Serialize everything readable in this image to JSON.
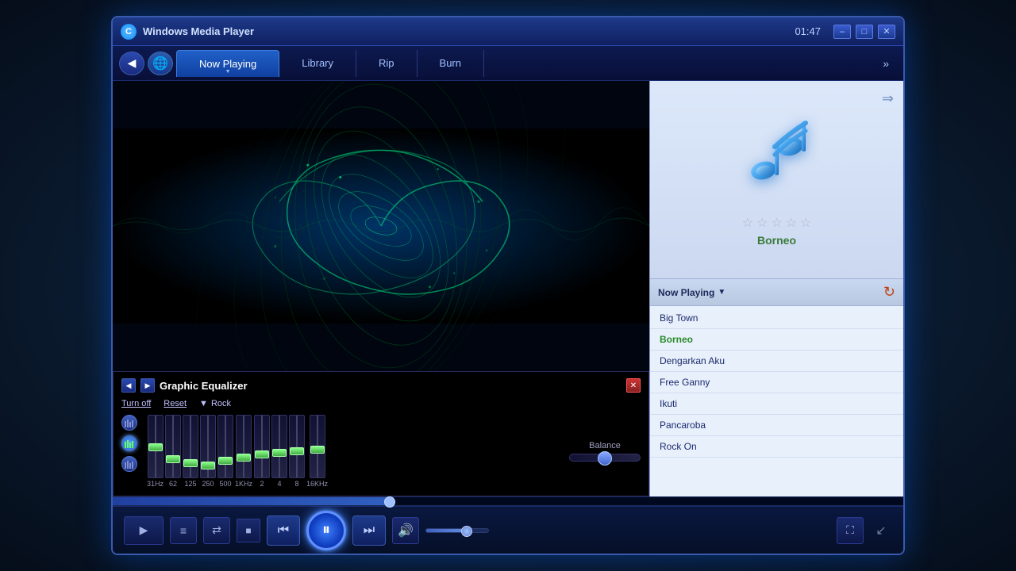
{
  "window": {
    "title": "Windows Media Player",
    "time": "01:47",
    "icon": "C"
  },
  "titlebar": {
    "minimize_label": "–",
    "restore_label": "□",
    "close_label": "✕"
  },
  "navbar": {
    "tabs": [
      {
        "id": "now-playing",
        "label": "Now Playing",
        "active": true
      },
      {
        "id": "library",
        "label": "Library",
        "active": false
      },
      {
        "id": "rip",
        "label": "Rip",
        "active": false
      },
      {
        "id": "burn",
        "label": "Burn",
        "active": false
      }
    ],
    "more_label": "»"
  },
  "equalizer": {
    "title": "Graphic Equalizer",
    "turn_off_label": "Turn off",
    "reset_label": "Reset",
    "preset_label": "Rock",
    "close_label": "✕",
    "frequencies": [
      "31Hz",
      "62",
      "125",
      "250",
      "500",
      "1KHz",
      "2",
      "4",
      "8",
      "16KHz"
    ],
    "slider_positions": [
      50,
      35,
      30,
      28,
      32,
      35,
      38,
      40,
      42,
      48
    ],
    "balance_label": "Balance"
  },
  "right_panel": {
    "song_title": "Borneo",
    "stars": [
      "☆",
      "☆",
      "☆",
      "☆",
      "☆"
    ],
    "nav_arrow": "⇒"
  },
  "playlist": {
    "header_label": "Now Playing",
    "dropdown_arrow": "▼",
    "shuffle_icon": "⟳",
    "items": [
      {
        "id": "big-town",
        "label": "Big Town",
        "active": false
      },
      {
        "id": "borneo",
        "label": "Borneo",
        "active": true
      },
      {
        "id": "dengarkan-aku",
        "label": "Dengarkan Aku",
        "active": false
      },
      {
        "id": "free-ganny",
        "label": "Free Ganny",
        "active": false
      },
      {
        "id": "ikuti",
        "label": "Ikuti",
        "active": false
      },
      {
        "id": "pancaroba",
        "label": "Pancaroba",
        "active": false
      },
      {
        "id": "rock-on",
        "label": "Rock On",
        "active": false
      }
    ]
  },
  "controls": {
    "play_label": "▶",
    "playlist_label": "≡",
    "shuffle_label": "⇄",
    "stop_label": "■",
    "prev_label": "⏮",
    "pause_label": "⏸",
    "next_label": "⏭",
    "volume_icon": "🔊",
    "fullscreen_label": "⛶",
    "minimize_label": "↙",
    "progress_percent": 35,
    "volume_percent": 65
  }
}
